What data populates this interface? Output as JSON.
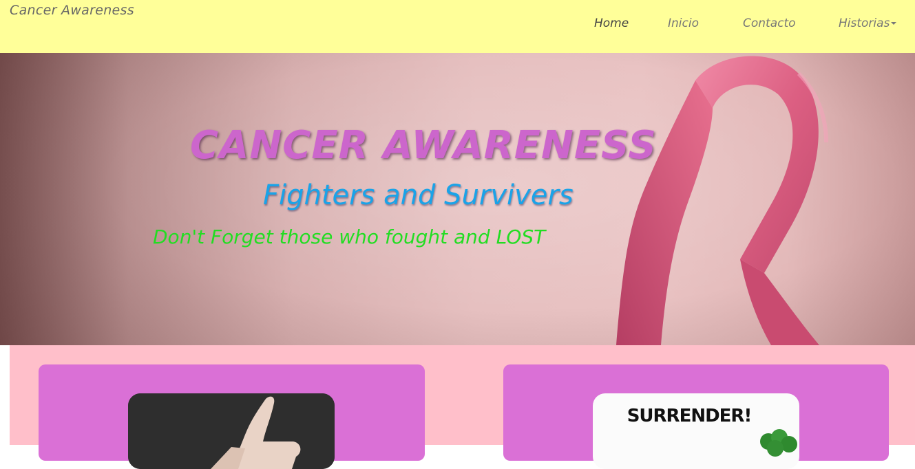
{
  "navbar": {
    "brand": "Cancer Awareness",
    "links": [
      {
        "label": "Home"
      },
      {
        "label": "Inicio"
      },
      {
        "label": "Contacto"
      },
      {
        "label": "Historias"
      }
    ]
  },
  "hero": {
    "title": "CANCER AWARENESS",
    "subtitle": "Fighters and Survivers",
    "tagline": "Don't Forget those who fought and LOST"
  },
  "cards": [
    {
      "image": "hand-thumbs-up-photo"
    },
    {
      "image": "surrender-poster",
      "image_text": "SURRENDER!"
    }
  ],
  "colors": {
    "navbar_bg": "#ffff99",
    "title": "#cc66cc",
    "subtitle": "#1aa3e8",
    "tagline": "#22dd22",
    "content_bg": "#ffbfca",
    "card_bg": "#da70d6",
    "ribbon": "#e0607e"
  }
}
